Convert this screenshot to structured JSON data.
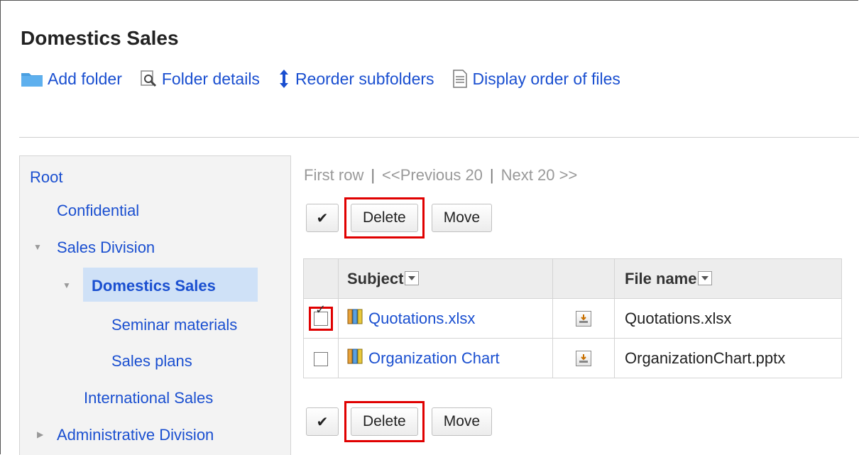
{
  "page": {
    "title": "Domestics Sales"
  },
  "actions": [
    {
      "label": "Add folder",
      "icon": "folder-icon"
    },
    {
      "label": "Folder details",
      "icon": "magnifier-icon"
    },
    {
      "label": "Reorder subfolders",
      "icon": "updown-arrow-icon"
    },
    {
      "label": "Display order of files",
      "icon": "document-icon"
    }
  ],
  "tree": {
    "root": "Root",
    "confidential": "Confidential",
    "sales_division": "Sales Division",
    "domestics_sales": "Domestics Sales",
    "seminar_materials": "Seminar materials",
    "sales_plans": "Sales plans",
    "international_sales": "International Sales",
    "administrative_division": "Administrative Division"
  },
  "pager": {
    "first": "First row",
    "sep": "|",
    "prev": "<<Previous 20",
    "next": "Next 20 >>"
  },
  "buttons": {
    "check_all": "✔",
    "delete": "Delete",
    "move": "Move"
  },
  "table": {
    "headers": {
      "subject": "Subject",
      "file_name": "File name"
    },
    "rows": [
      {
        "subject": "Quotations.xlsx",
        "file_name": "Quotations.xlsx",
        "checked": true
      },
      {
        "subject": "Organization Chart",
        "file_name": "OrganizationChart.pptx",
        "checked": false
      }
    ]
  },
  "colors": {
    "link": "#1a4fd0",
    "highlight": "#e00000",
    "selected_bg": "#cfe1f7",
    "sidebar_bg": "#f3f3f3"
  }
}
